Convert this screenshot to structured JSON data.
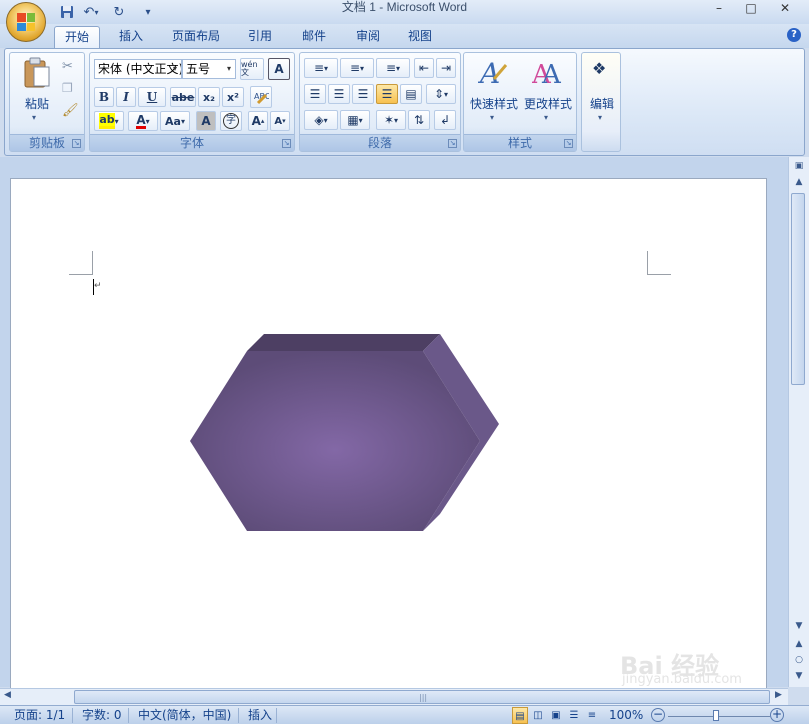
{
  "window": {
    "title": "文档 1 - Microsoft Word"
  },
  "tabs": [
    {
      "label": "开始",
      "active": true
    },
    {
      "label": "插入"
    },
    {
      "label": "页面布局"
    },
    {
      "label": "引用"
    },
    {
      "label": "邮件"
    },
    {
      "label": "审阅"
    },
    {
      "label": "视图"
    }
  ],
  "ribbon": {
    "clipboard": {
      "label": "剪贴板",
      "paste": "粘贴"
    },
    "font": {
      "label": "字体",
      "font_name": "宋体 (中文正文)",
      "font_size": "五号",
      "bold": "B",
      "italic": "I",
      "underline": "U",
      "strike": "abe",
      "subscript": "x₂",
      "superscript": "x²",
      "char_case": "Aa",
      "grow": "A",
      "shrink": "A",
      "font_color": "A",
      "char_shading": "A",
      "enclose": "字",
      "phonetic": "wén 文"
    },
    "paragraph": {
      "label": "段落"
    },
    "styles": {
      "label": "样式",
      "quick_styles": "快速样式",
      "change_styles": "更改样式"
    },
    "editing": {
      "label": "编辑"
    }
  },
  "status": {
    "page": "页面: 1/1",
    "words": "字数: 0",
    "language": "中文(简体，中国)",
    "insert_mode": "插入",
    "zoom": "100%"
  },
  "colors": {
    "hexagon_main": "#6e5a8c",
    "hexagon_highlight": "#8368a6",
    "hexagon_top": "#4d3f63",
    "hexagon_side": "#5c4a78"
  },
  "watermark": {
    "text": "Bai 经验",
    "sub": "jingyan.baidu.com"
  }
}
